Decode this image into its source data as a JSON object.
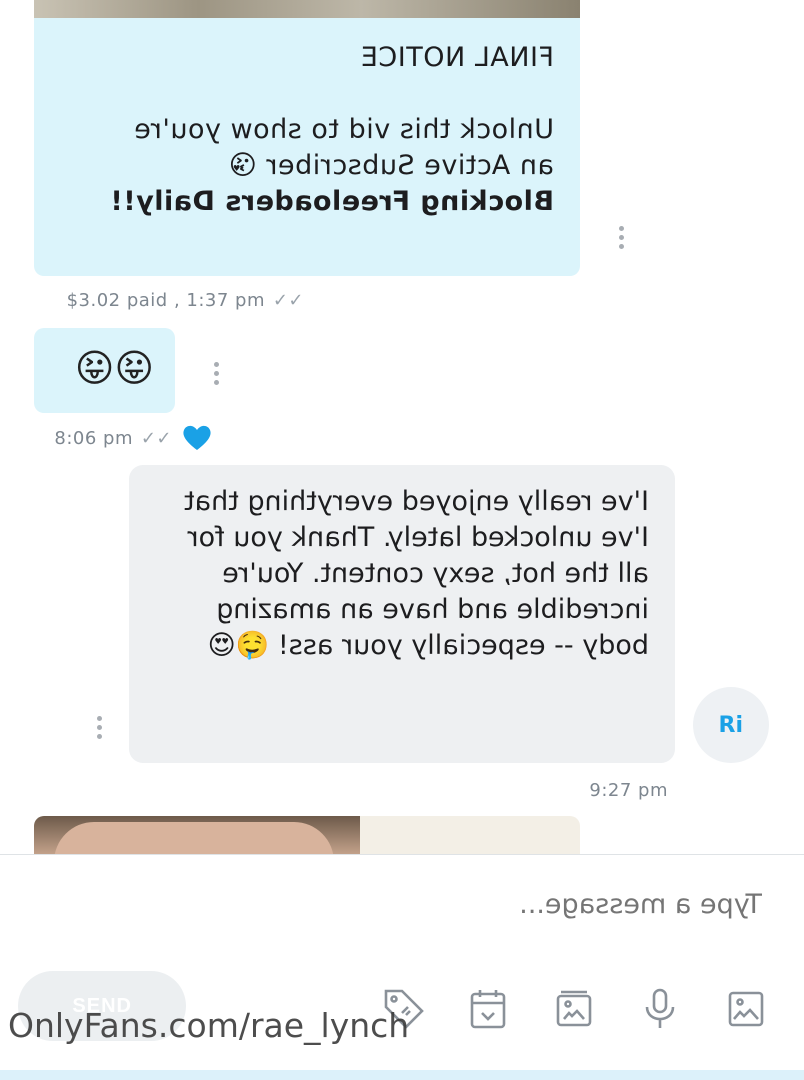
{
  "messages": [
    {
      "sender": "creator",
      "lines": [
        "FINAL NOTICE",
        "",
        "Unlock this vid to show you're",
        "an Active Subscriber 😘"
      ],
      "bold_line": "Blocking Freeloaders Daily!!",
      "meta": "$3.02 paid , 1:37 pm"
    },
    {
      "sender": "creator",
      "text": "😜😜",
      "meta": "8:06 pm"
    },
    {
      "sender": "fan",
      "avatar_initials": "Ri",
      "text": "I've really enjoyed everything that I've unlocked lately. Thank you for all the hot, sexy content. You're incredible and have an amazing body -- especially your ass! 🤤😍",
      "meta": "9:27 pm"
    }
  ],
  "composer": {
    "placeholder": "Type a message...",
    "send_label": "SEND",
    "tools": [
      "image-icon",
      "microphone-icon",
      "gallery-icon",
      "calendar-icon",
      "price-tag-icon"
    ]
  },
  "watermark": "OnlyFans.com/rae_lynch",
  "colors": {
    "creator_bubble": "#dbf4fb",
    "fan_bubble": "#eef0f2",
    "accent": "#1aa1e6",
    "icon_grey": "#8a9199"
  }
}
